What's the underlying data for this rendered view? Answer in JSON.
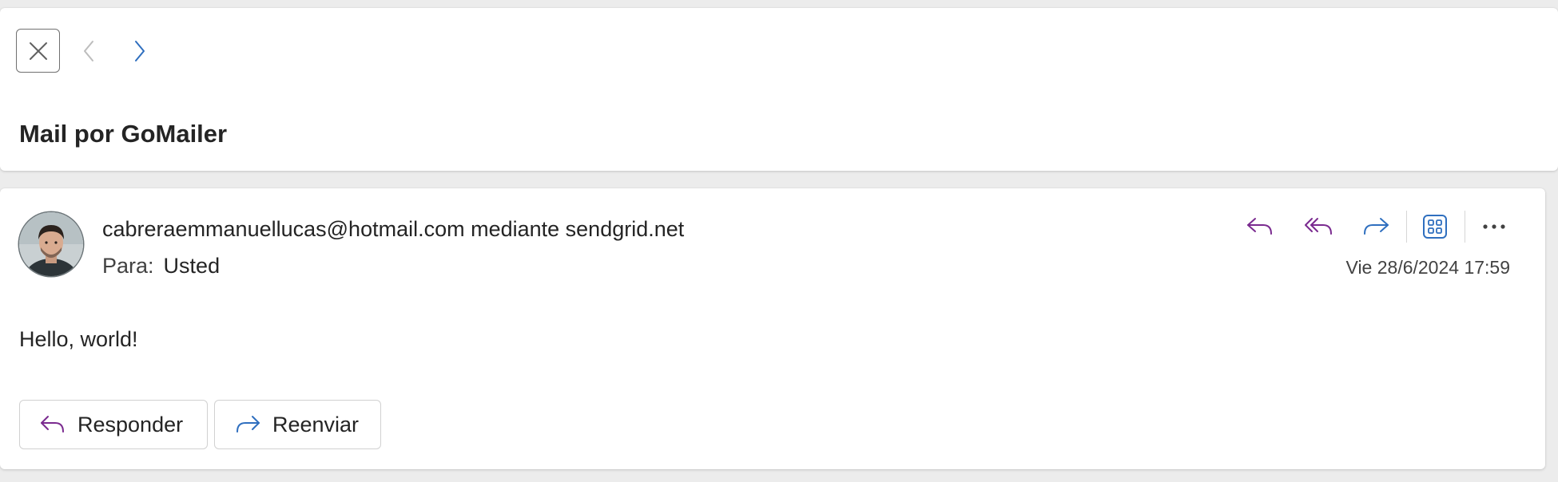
{
  "header": {
    "subject": "Mail por GoMailer"
  },
  "message": {
    "sender": "cabreraemmanuellucas@hotmail.com mediante sendgrid.net",
    "to_label": "Para:",
    "to_value": "Usted",
    "date": "Vie 28/6/2024 17:59",
    "body": "Hello, world!"
  },
  "actions": {
    "reply_label": "Responder",
    "forward_label": "Reenviar"
  },
  "icons": {
    "close": "close-icon",
    "prev": "chevron-left-icon",
    "next": "chevron-right-icon",
    "reply": "reply-icon",
    "reply_all": "reply-all-icon",
    "forward": "forward-icon",
    "apps": "apps-icon",
    "more": "more-icon"
  },
  "colors": {
    "reply_accent": "#7a2a8f",
    "forward_accent": "#2f6fbf",
    "apps_accent": "#2f6fbf",
    "nav_active": "#2f6fbf",
    "nav_disabled": "#bdbdbd"
  }
}
